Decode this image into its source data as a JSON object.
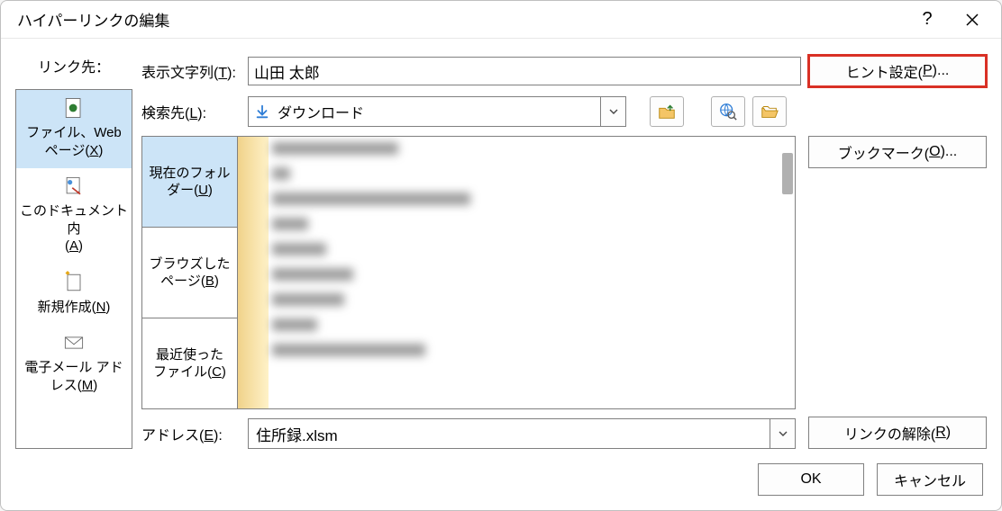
{
  "title": "ハイパーリンクの編集",
  "sidebar": {
    "label": "リンク先：",
    "items": [
      {
        "label_a": "ファイル、Web",
        "label_b": "ページ(",
        "accel": "X",
        "tail": ")"
      },
      {
        "label_a": "このドキュメント内",
        "label_b": "(",
        "accel": "A",
        "tail": ")"
      },
      {
        "label_a": "新規作成(",
        "accel": "N",
        "tail": ")"
      },
      {
        "label_a": "電子メール アド",
        "label_b": "レス(",
        "accel": "M",
        "tail": ")"
      }
    ]
  },
  "display_text": {
    "label": "表示文字列(",
    "accel": "T",
    "tail": "):",
    "value": "山田 太郎"
  },
  "hint_btn": {
    "label": "ヒント設定(",
    "accel": "P",
    "tail": ")..."
  },
  "lookin": {
    "label": "検索先(",
    "accel": "L",
    "tail": "):",
    "value": "ダウンロード"
  },
  "browse_tabs": [
    {
      "label_a": "現在のフォル",
      "label_b": "ダー(",
      "accel": "U",
      "tail": ")"
    },
    {
      "label_a": "ブラウズした",
      "label_b": "ページ(",
      "accel": "B",
      "tail": ")"
    },
    {
      "label_a": "最近使った",
      "label_b": "ファイル(",
      "accel": "C",
      "tail": ")"
    }
  ],
  "bookmark_btn": {
    "label": "ブックマーク(",
    "accel": "O",
    "tail": ")..."
  },
  "address": {
    "label": "アドレス(",
    "accel": "E",
    "tail": "):",
    "value": "住所録.xlsm"
  },
  "remove_btn": {
    "label": "リンクの解除(",
    "accel": "R",
    "tail": ")"
  },
  "footer": {
    "ok": "OK",
    "cancel": "キャンセル"
  }
}
